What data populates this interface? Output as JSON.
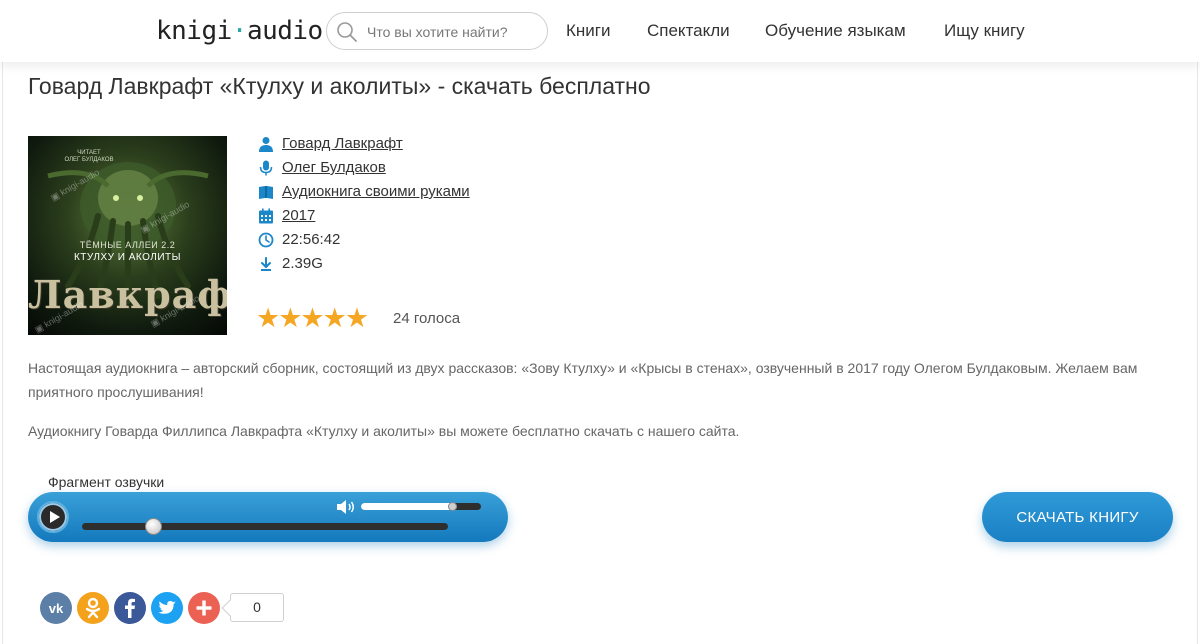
{
  "header": {
    "logo_left": "knigi",
    "logo_dot": "·",
    "logo_right": "audio",
    "search_placeholder": "Что вы хотите найти?",
    "nav": [
      "Книги",
      "Спектакли",
      "Обучение языкам",
      "Ищу книгу"
    ]
  },
  "page_title": "Говард Лавкрафт «Ктулху и аколиты» - скачать бесплатно",
  "cover": {
    "reader_caption": "ЧИТАЕТ\nОЛЕГ БУЛДАКОВ",
    "series": "ТЁМНЫЕ АЛЛЕИ 2.2",
    "book": "КТУЛХУ И АКОЛИТЫ",
    "author": "Лавкрафт"
  },
  "meta": {
    "author": "Говард Лавкрафт",
    "narrator": "Олег Булдаков",
    "genre": "Аудиокнига своими руками",
    "year": "2017",
    "duration": "22:56:42",
    "size": "2.39G"
  },
  "rating": {
    "stars": "★★★★★",
    "value": 5,
    "max": 5,
    "votes": "24 голоса"
  },
  "description": {
    "paragraph1": "Настоящая аудиокнига – авторский сборник, состоящий из двух рассказов: «Зову Ктулху» и «Крысы в стенах», озвученный в 2017 году Олегом Булдаковым. Желаем вам приятного прослушивания!",
    "paragraph2": "Аудиокнигу Говарда Филлипса Лавкрафта «Ктулху и аколиты» вы можете бесплатно скачать с нашего сайта."
  },
  "player": {
    "label": "Фрагмент озвучки",
    "progress_fraction": 0.25,
    "volume_fraction": 0.8
  },
  "download_button": "СКАЧАТЬ КНИГУ",
  "social": {
    "networks": [
      "vk-icon",
      "odnoklassniki-icon",
      "facebook-icon",
      "twitter-icon",
      "more-icon"
    ],
    "share_count": "0"
  }
}
